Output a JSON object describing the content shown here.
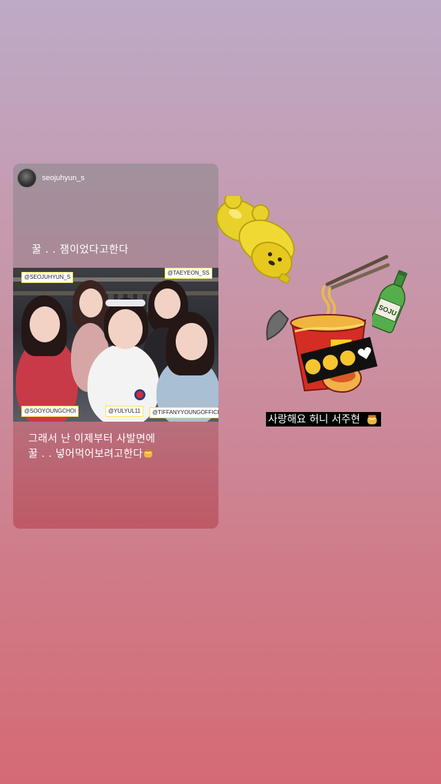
{
  "shared_post": {
    "username": "seojuhyun_s",
    "caption_top": "꿀 . . 잼이었다고한다",
    "caption_bottom_line1": "그래서 난 이제부터 사발면에",
    "caption_bottom_line2": "꿀 . . 넣어먹어보려고한다",
    "tags": {
      "tag1": "@SEOJUHYUN_S",
      "tag2": "@TAEYEON_SS",
      "tag3": "@SOOYOUNGCHOI",
      "tag4": "@YULYUL11",
      "tag5": "@TIFFANYYOUNGOFFICIAL"
    }
  },
  "stickers": {
    "bottle_label": "SOJU",
    "banner_text": "사랑해요 허니 서주현"
  },
  "colors": {
    "background_top": "#bdaac6",
    "background_bottom": "#d46a74",
    "honey": "#e8d12a",
    "cup_red": "#d42d24"
  },
  "icons": {
    "honey_bear": "honey-bear-sticker",
    "ramen_cup": "ramen-cup-sticker",
    "soju_bottle": "soju-bottle-sticker",
    "honey_pot": "honey-pot-emoji"
  }
}
